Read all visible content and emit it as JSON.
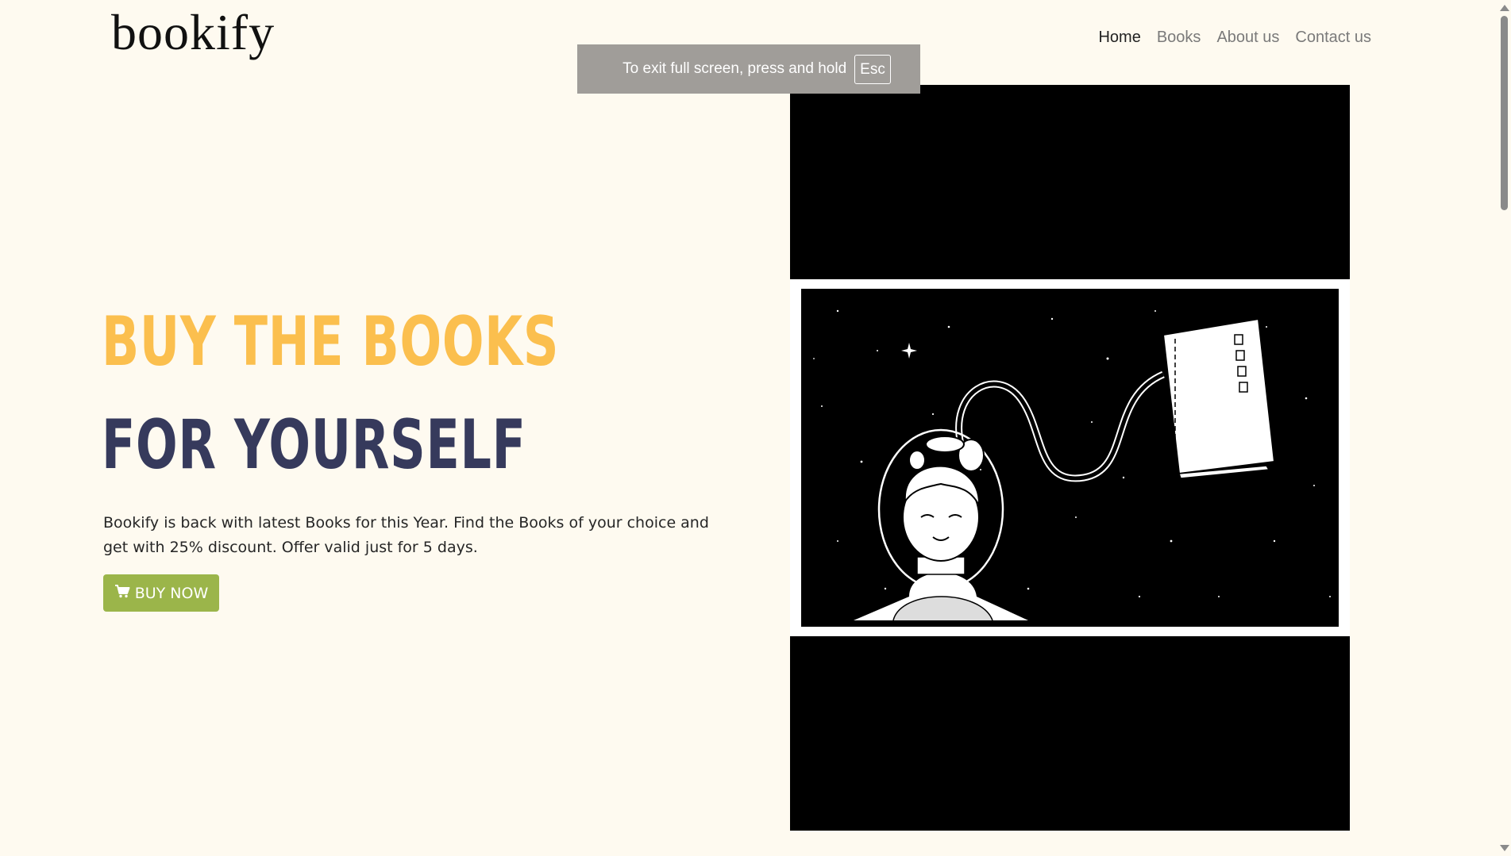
{
  "brand": {
    "logo": "bookify"
  },
  "nav": {
    "items": [
      {
        "label": "Home",
        "active": true
      },
      {
        "label": "Books",
        "active": false
      },
      {
        "label": "About us",
        "active": false
      },
      {
        "label": "Contact us",
        "active": false
      }
    ]
  },
  "fullscreen_notice": {
    "text": "To exit full screen, press and hold",
    "key": "Esc"
  },
  "hero": {
    "title_line1": "BUY THE BOOKS",
    "title_line2": "FOR YOURSELF",
    "description": "Bookify is back with latest Books for this Year. Find the Books of your choice and get with 25% discount. Offer valid just for 5 days.",
    "cta_label": "BUY NOW",
    "cta_icon": "cart-icon"
  },
  "colors": {
    "background": "#fefaf0",
    "title_accent": "#fbbf4e",
    "title_dark": "#363a5c",
    "button": "#9bb54a"
  },
  "media": {
    "icon": "boy-astronaut-with-book-illustration"
  }
}
